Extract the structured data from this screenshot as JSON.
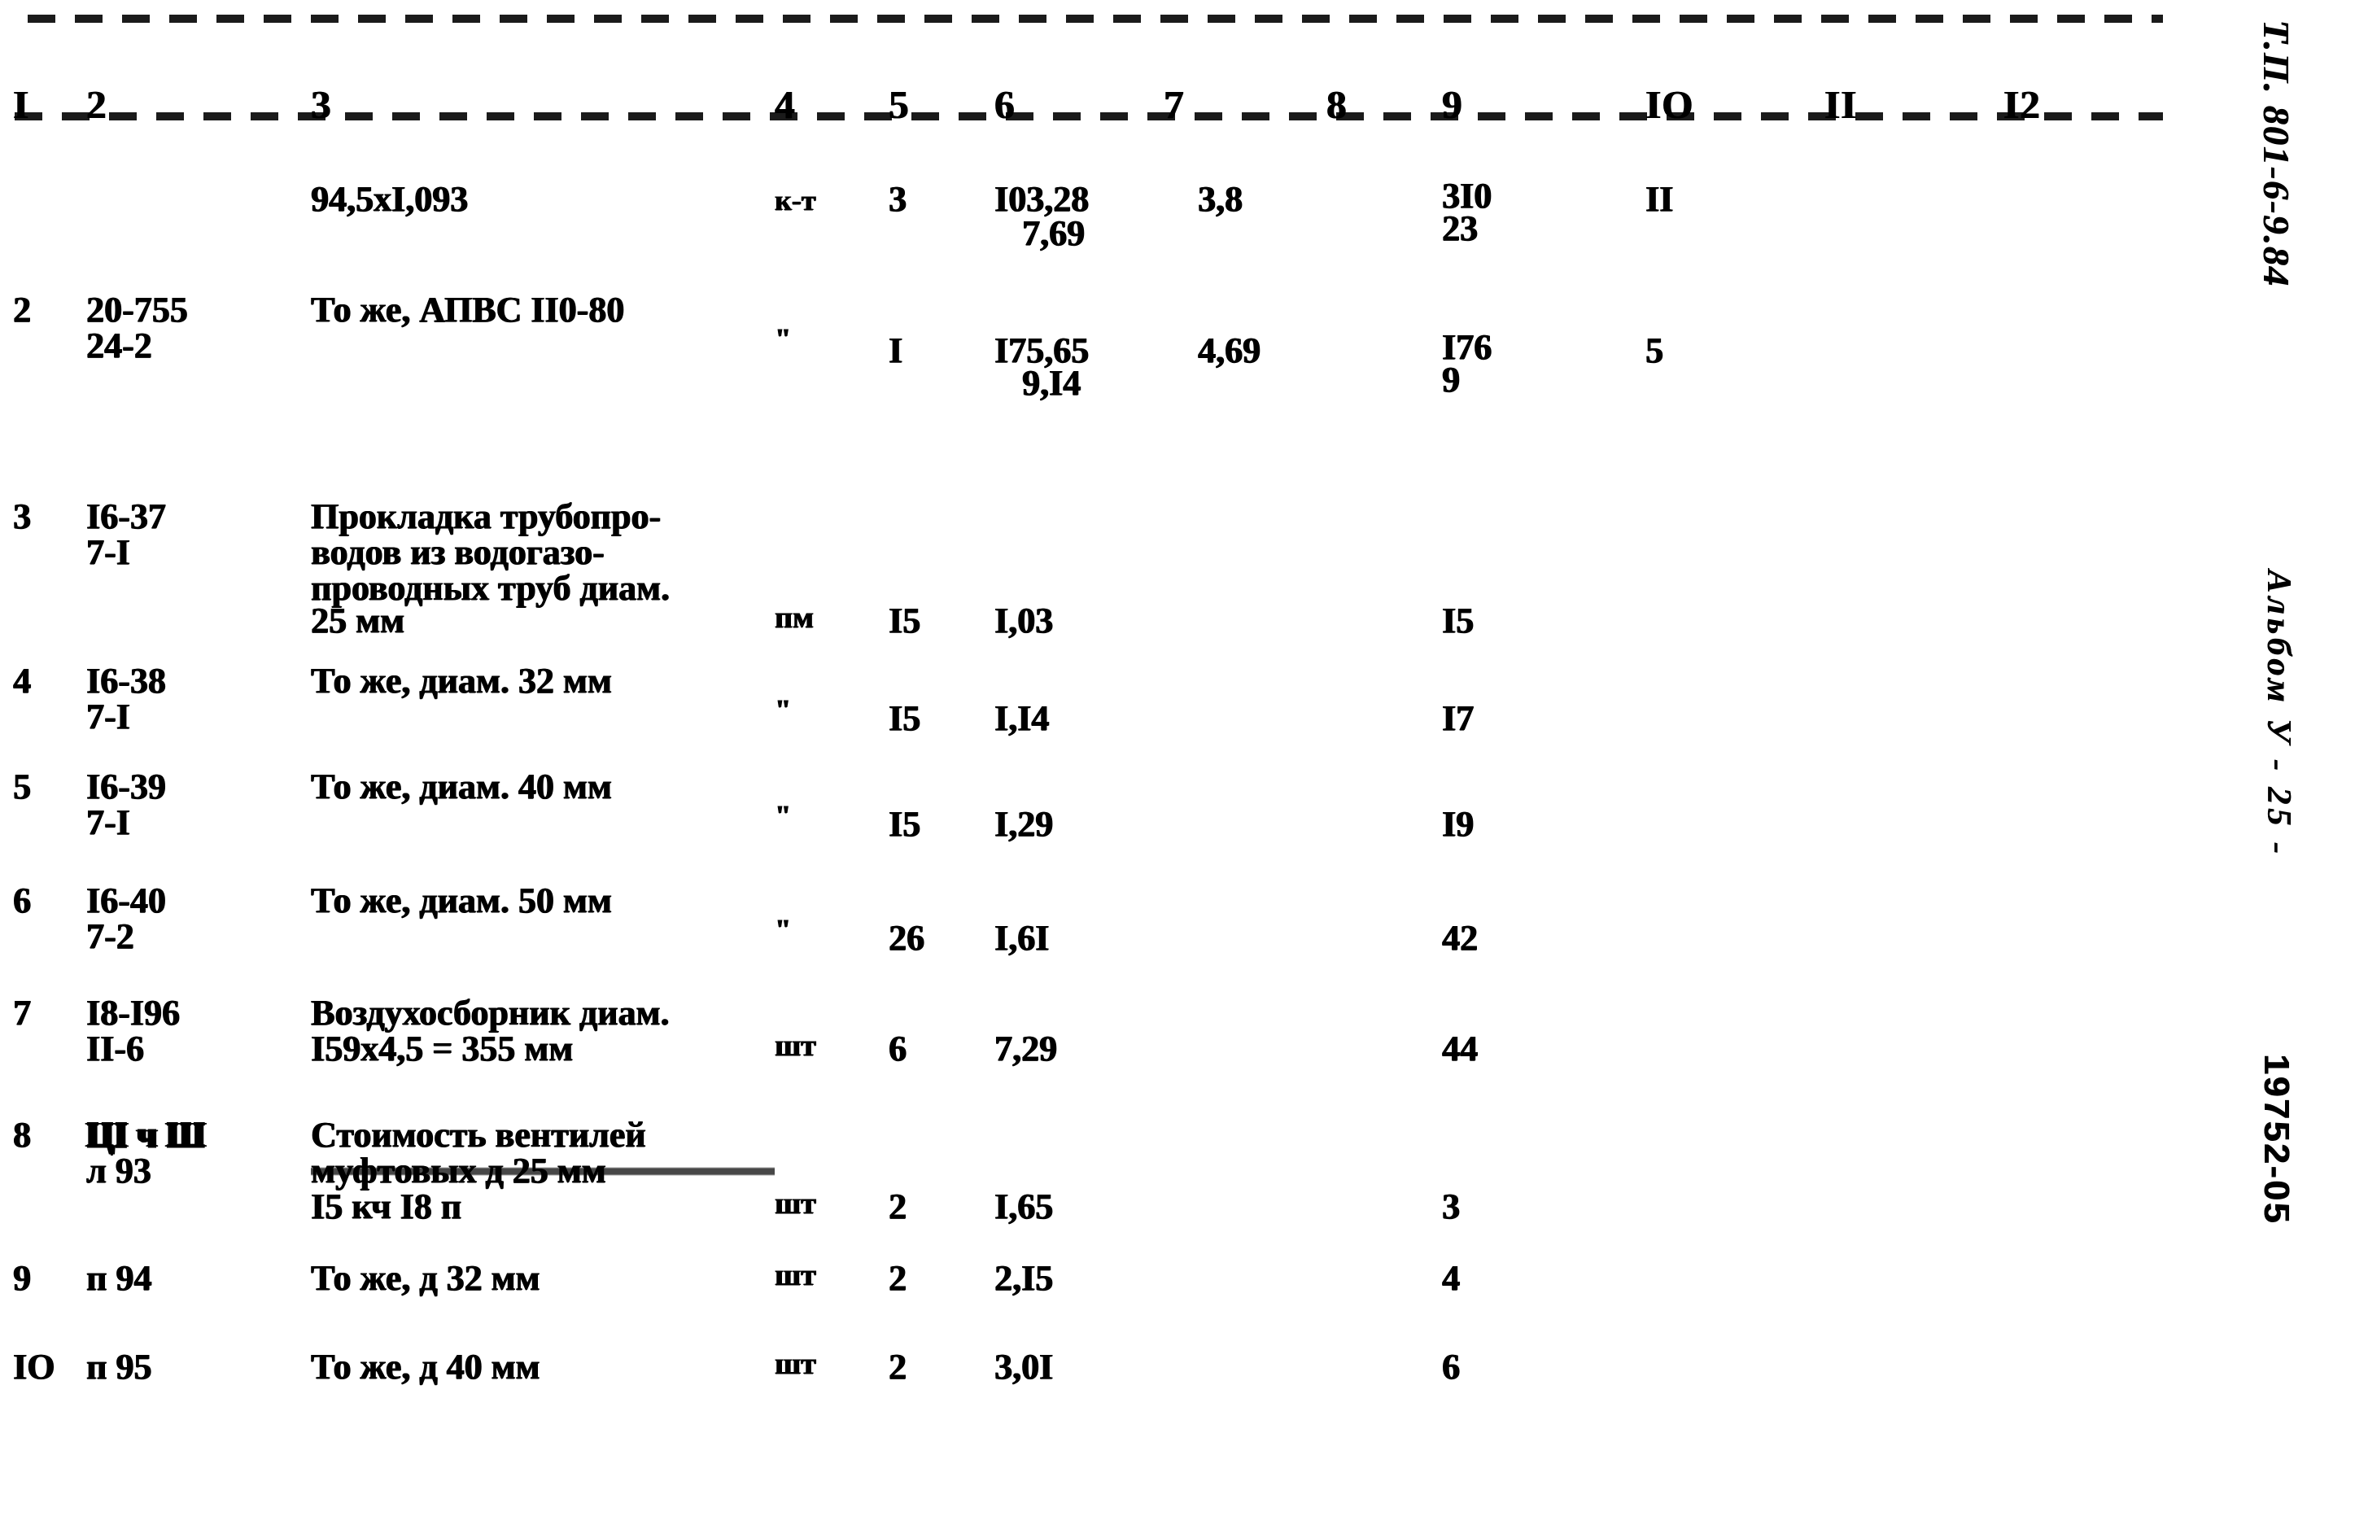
{
  "document": {
    "type": "scanned-specification-table",
    "column_headers": [
      "I",
      "2",
      "3",
      "4",
      "5",
      "6",
      "7",
      "8",
      "9",
      "IO",
      "II",
      "I2"
    ],
    "margin": {
      "project": "Т.П. 801-6-9.84",
      "album": "Альбом У - 25 -",
      "code": "19752-05"
    }
  },
  "rows": [
    {
      "num": "",
      "code": "",
      "code2": "",
      "desc": "94,5xI,093",
      "desc2": "",
      "desc3": "",
      "desc4": "",
      "unit": "к-т",
      "qty": "3",
      "price": "I03,28",
      "price2": "7,69",
      "col7": "3,8",
      "col8": "",
      "total": "3I0",
      "total2": "23",
      "col10": "II",
      "col11": "",
      "col12": ""
    },
    {
      "num": "2",
      "code": "20-755",
      "code2": "24-2",
      "desc": "То же, АПВС II0-80",
      "desc2": "",
      "desc3": "",
      "desc4": "",
      "unit": "\"",
      "qty": "I",
      "price": "I75,65",
      "price2": "9,I4",
      "col7": "4,69",
      "col8": "",
      "total": "I76",
      "total2": "9",
      "col10": "5",
      "col11": "",
      "col12": ""
    },
    {
      "num": "3",
      "code": "I6-37",
      "code2": "7-I",
      "desc": "Прокладка трубопро-",
      "desc2": "водов из водогазо-",
      "desc3": "проводных труб диам.",
      "desc4": "25 мм",
      "unit": "пм",
      "qty": "I5",
      "price": "I,03",
      "price2": "",
      "col7": "",
      "col8": "",
      "total": "I5",
      "total2": "",
      "col10": "",
      "col11": "",
      "col12": ""
    },
    {
      "num": "4",
      "code": "I6-38",
      "code2": "7-I",
      "desc": "То же, диам. 32 мм",
      "desc2": "",
      "desc3": "",
      "desc4": "",
      "unit": "\"",
      "qty": "I5",
      "price": "I,I4",
      "price2": "",
      "col7": "",
      "col8": "",
      "total": "I7",
      "total2": "",
      "col10": "",
      "col11": "",
      "col12": ""
    },
    {
      "num": "5",
      "code": "I6-39",
      "code2": "7-I",
      "desc": "То же, диам. 40 мм",
      "desc2": "",
      "desc3": "",
      "desc4": "",
      "unit": "\"",
      "qty": "I5",
      "price": "I,29",
      "price2": "",
      "col7": "",
      "col8": "",
      "total": "I9",
      "total2": "",
      "col10": "",
      "col11": "",
      "col12": ""
    },
    {
      "num": "6",
      "code": "I6-40",
      "code2": "7-2",
      "desc": "То же, диам. 50 мм",
      "desc2": "",
      "desc3": "",
      "desc4": "",
      "unit": "\"",
      "qty": "26",
      "price": "I,6I",
      "price2": "",
      "col7": "",
      "col8": "",
      "total": "42",
      "total2": "",
      "col10": "",
      "col11": "",
      "col12": ""
    },
    {
      "num": "7",
      "code": "I8-I96",
      "code2": "II-6",
      "desc": "Воздухосборник диам.",
      "desc2": "I59x4,5 = 355 мм",
      "desc3": "",
      "desc4": "",
      "unit": "шт",
      "qty": "6",
      "price": "7,29",
      "price2": "",
      "col7": "",
      "col8": "",
      "total": "44",
      "total2": "",
      "col10": "",
      "col11": "",
      "col12": ""
    },
    {
      "num": "8",
      "code": "ЦI ч Ш",
      "code2": "л 93",
      "desc": "Стоимость вентилей",
      "desc2": "муфтовых д 25 мм",
      "desc3": "I5 кч I8 п",
      "desc4": "",
      "unit": "шт",
      "qty": "2",
      "price": "I,65",
      "price2": "",
      "col7": "",
      "col8": "",
      "total": "3",
      "total2": "",
      "col10": "",
      "col11": "",
      "col12": ""
    },
    {
      "num": "9",
      "code": "п 94",
      "code2": "",
      "desc": "То же, д 32 мм",
      "desc2": "",
      "desc3": "",
      "desc4": "",
      "unit": "шт",
      "qty": "2",
      "price": "2,I5",
      "price2": "",
      "col7": "",
      "col8": "",
      "total": "4",
      "total2": "",
      "col10": "",
      "col11": "",
      "col12": ""
    },
    {
      "num": "IO",
      "code": "п 95",
      "code2": "",
      "desc": "То же, д 40 мм",
      "desc2": "",
      "desc3": "",
      "desc4": "",
      "unit": "шт",
      "qty": "2",
      "price": "3,0I",
      "price2": "",
      "col7": "",
      "col8": "",
      "total": "6",
      "total2": "",
      "col10": "",
      "col11": "",
      "col12": ""
    }
  ]
}
